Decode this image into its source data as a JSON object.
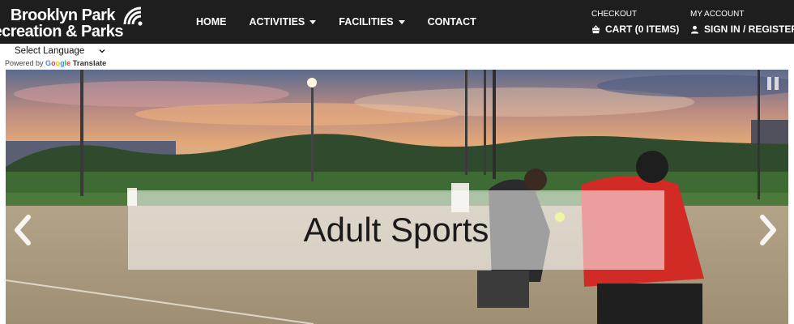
{
  "logo": {
    "line1": "Brooklyn Park",
    "line2": "Recreation & Parks",
    "icon": "wifi-signal-icon"
  },
  "nav": [
    {
      "label": "HOME",
      "dropdown": false
    },
    {
      "label": "ACTIVITIES",
      "dropdown": true
    },
    {
      "label": "FACILITIES",
      "dropdown": true
    },
    {
      "label": "CONTACT",
      "dropdown": false
    }
  ],
  "checkout": {
    "small": "CHECKOUT",
    "label": "CART (0 ITEMS)",
    "icon": "cart-icon"
  },
  "account": {
    "small": "MY ACCOUNT",
    "label": "SIGN IN / REGISTER",
    "icon": "user-icon"
  },
  "translate": {
    "select_label": "Select Language",
    "powered_by": "Powered by",
    "google": "Google",
    "translate": "Translate"
  },
  "hero": {
    "caption": "Adult Sports",
    "prev_icon": "chevron-left-icon",
    "next_icon": "chevron-right-icon",
    "pause_icon": "pause-icon"
  },
  "colors": {
    "topbar": "#1e1e1e",
    "grass": "#4d7a3a",
    "dirt": "#a8977a"
  }
}
